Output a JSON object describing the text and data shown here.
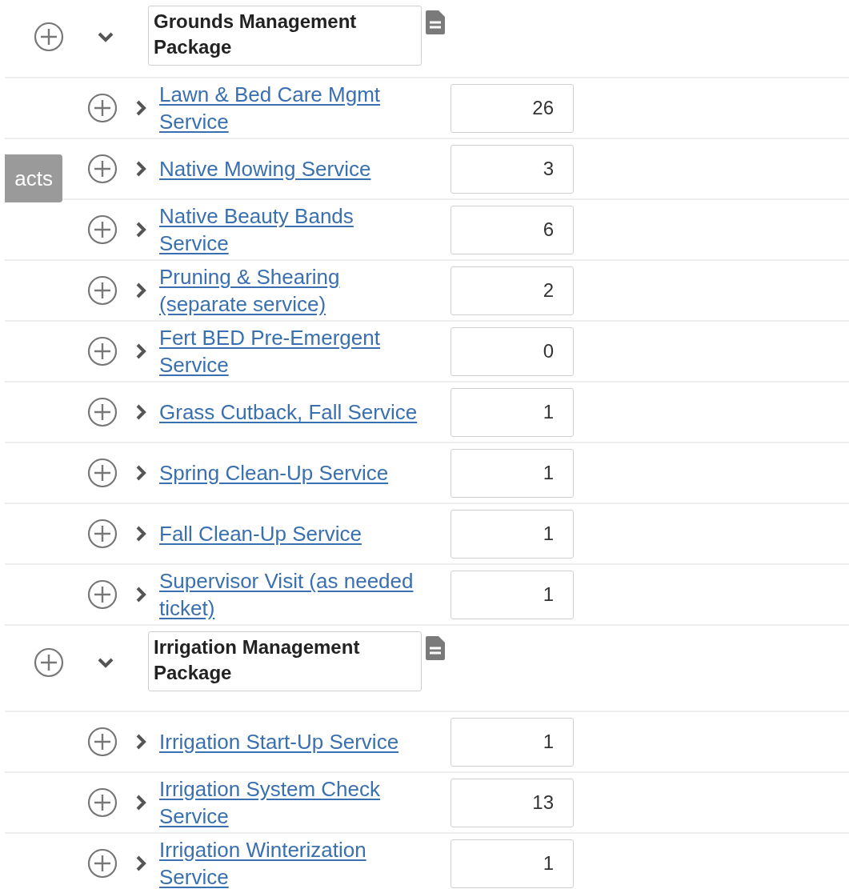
{
  "side_tab": {
    "label": "acts"
  },
  "packages": [
    {
      "title": "Grounds Management Package",
      "expanded": true,
      "children": [
        {
          "label": "Lawn & Bed Care Mgmt Service",
          "value": "26",
          "expanded": false
        },
        {
          "label": "Native Mowing Service",
          "value": "3",
          "expanded": false
        },
        {
          "label": "Native Beauty Bands Service",
          "value": "6",
          "expanded": false
        },
        {
          "label": "Pruning & Shearing (separate service)",
          "value": "2",
          "expanded": false
        },
        {
          "label": "Fert BED Pre-Emergent Service",
          "value": "0",
          "expanded": false
        },
        {
          "label": "Grass Cutback, Fall Service",
          "value": "1",
          "expanded": false
        },
        {
          "label": "Spring Clean-Up Service",
          "value": "1",
          "expanded": false
        },
        {
          "label": "Fall Clean-Up Service",
          "value": "1",
          "expanded": false
        },
        {
          "label": "Supervisor Visit (as needed ticket)",
          "value": "1",
          "expanded": false
        }
      ]
    },
    {
      "title": "Irrigation Management Package",
      "expanded": true,
      "children": [
        {
          "label": "Irrigation Start-Up Service",
          "value": "1",
          "expanded": false
        },
        {
          "label": "Irrigation System Check Service",
          "value": "13",
          "expanded": false
        },
        {
          "label": "Irrigation Winterization Service",
          "value": "1",
          "expanded": false
        }
      ]
    }
  ]
}
